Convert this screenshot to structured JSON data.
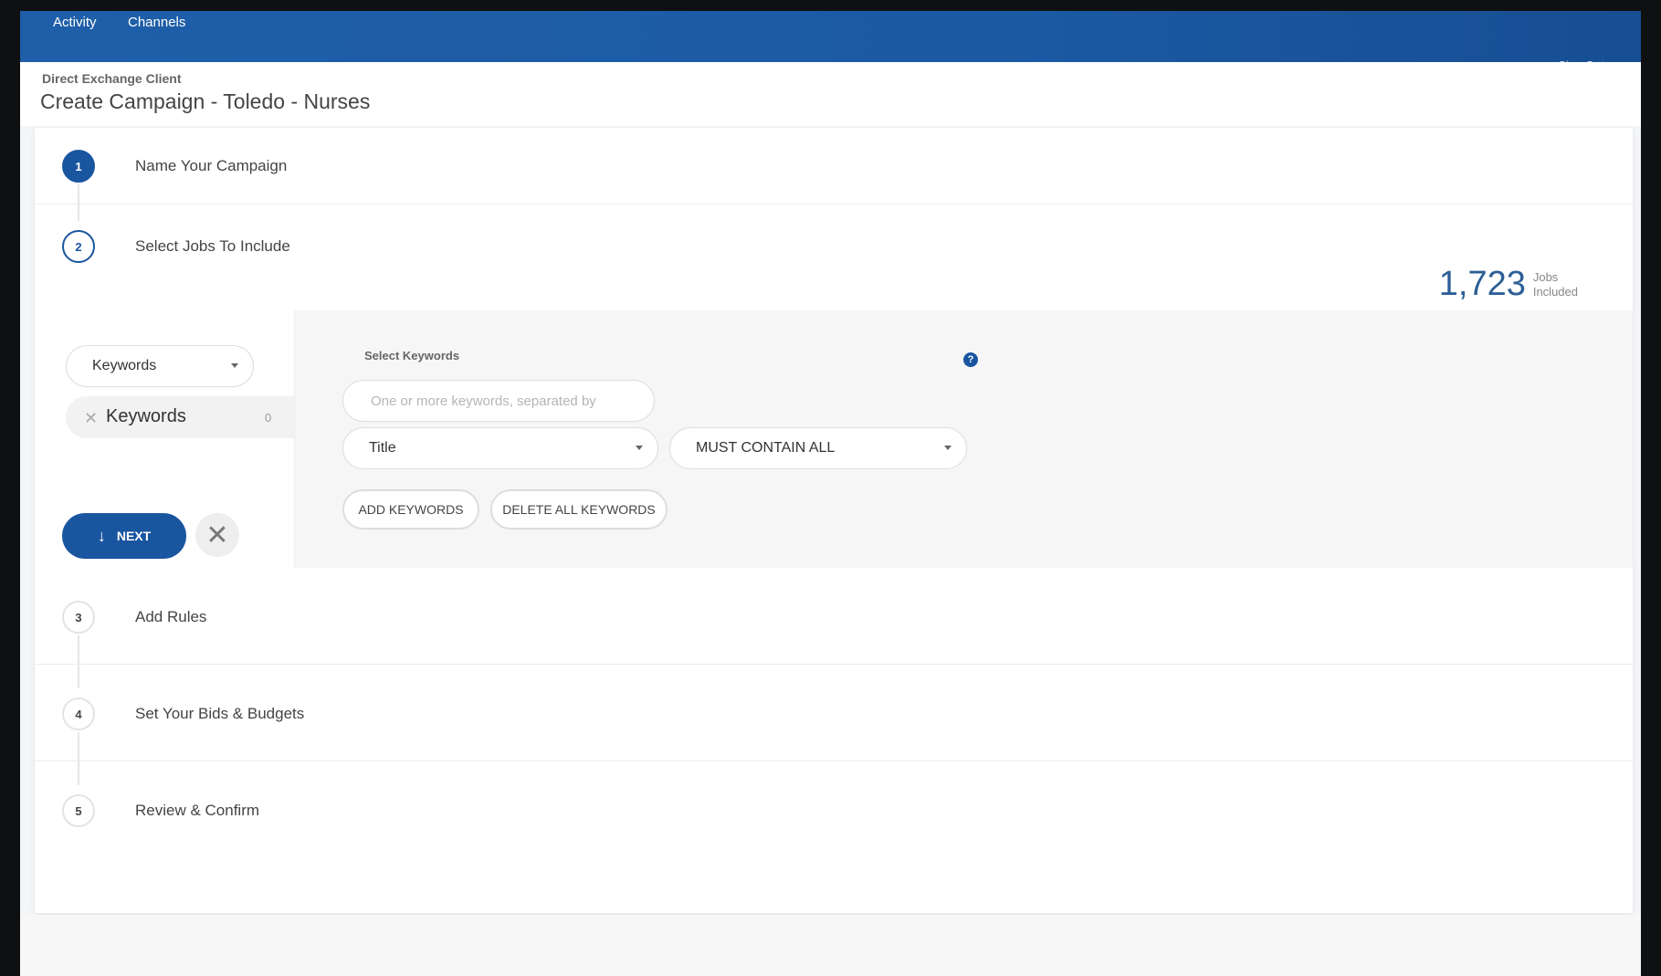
{
  "nav": {
    "items": [
      "Activity",
      "Channels"
    ],
    "signout": "Sign Out"
  },
  "header": {
    "client": "Direct Exchange Client",
    "title": "Create Campaign - Toledo - Nurses"
  },
  "steps": [
    {
      "number": "1",
      "label": "Name Your Campaign"
    },
    {
      "number": "2",
      "label": "Select Jobs To Include"
    },
    {
      "number": "3",
      "label": "Add Rules"
    },
    {
      "number": "4",
      "label": "Set Your Bids & Budgets"
    },
    {
      "number": "5",
      "label": "Review & Confirm"
    }
  ],
  "jobs": {
    "count": "1,723",
    "label_line1": "Jobs",
    "label_line2": "Included"
  },
  "filter": {
    "type_select": "Keywords",
    "chip_label": "Keywords",
    "chip_count": "0",
    "next_label": "NEXT",
    "cancel_symbol": "✕"
  },
  "keywords": {
    "section_label": "Select Keywords",
    "help": "?",
    "input_placeholder": "One or more keywords, separated by",
    "field_select": "Title",
    "match_select": "MUST CONTAIN ALL",
    "add_label": "ADD KEYWORDS",
    "delete_label": "DELETE ALL KEYWORDS"
  },
  "colors": {
    "primary": "#1a55a0",
    "nav": "#1f5ea8"
  }
}
